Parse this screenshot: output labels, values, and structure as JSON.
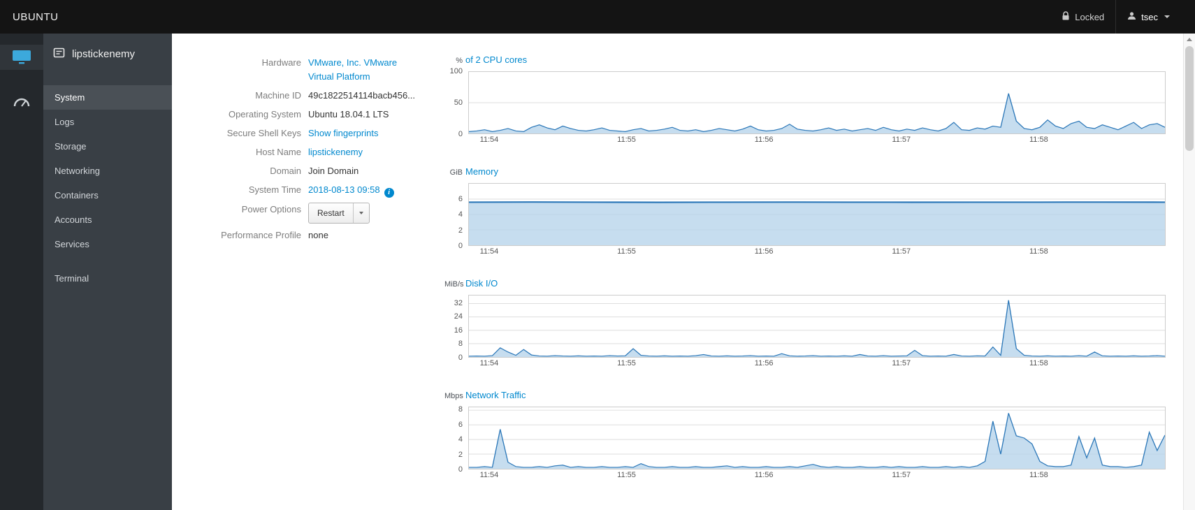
{
  "topbar": {
    "brand": "UBUNTU",
    "locked": "Locked",
    "user": "tsec"
  },
  "sidebar": {
    "host": "lipstickenemy",
    "items": [
      {
        "label": "System",
        "active": true
      },
      {
        "label": "Logs"
      },
      {
        "label": "Storage"
      },
      {
        "label": "Networking"
      },
      {
        "label": "Containers"
      },
      {
        "label": "Accounts"
      },
      {
        "label": "Services"
      },
      {
        "label": "Terminal"
      }
    ]
  },
  "details": {
    "hardware": {
      "label": "Hardware",
      "value": "VMware, Inc. VMware Virtual Platform"
    },
    "machine_id": {
      "label": "Machine ID",
      "value": "49c1822514114bacb456..."
    },
    "os": {
      "label": "Operating System",
      "value": "Ubuntu 18.04.1 LTS"
    },
    "ssh": {
      "label": "Secure Shell Keys",
      "value": "Show fingerprints"
    },
    "hostname": {
      "label": "Host Name",
      "value": "lipstickenemy"
    },
    "domain": {
      "label": "Domain",
      "value": "Join Domain"
    },
    "time": {
      "label": "System Time",
      "value": "2018-08-13 09:58",
      "info_icon": "i"
    },
    "power": {
      "label": "Power Options",
      "value": "Restart"
    },
    "profile": {
      "label": "Performance Profile",
      "value": "none"
    }
  },
  "colors": {
    "accent": "#0088ce",
    "chart_line": "#2b77b8",
    "chart_fill": "#b3d1ea",
    "grid": "#dedede",
    "topbar_bg": "#141414",
    "sidebar_bg": "#393f45",
    "sidebar_active_bg": "#4a5056"
  },
  "chart_data": [
    {
      "type": "area",
      "unit": "%",
      "title": "of 2 CPU cores",
      "ylim": [
        0,
        100
      ],
      "yticks": [
        0,
        50,
        100
      ],
      "x_labels": [
        "11:54",
        "11:55",
        "11:56",
        "11:57",
        "11:58"
      ],
      "x_fractions": [
        0.03,
        0.227,
        0.424,
        0.621,
        0.818
      ],
      "line_width": 1.2,
      "values": [
        3,
        4,
        6,
        3,
        5,
        8,
        4,
        3,
        10,
        14,
        9,
        6,
        12,
        8,
        5,
        4,
        6,
        9,
        5,
        4,
        3,
        6,
        8,
        4,
        5,
        7,
        10,
        5,
        4,
        6,
        3,
        5,
        8,
        6,
        4,
        7,
        12,
        6,
        4,
        5,
        8,
        15,
        7,
        5,
        4,
        6,
        9,
        5,
        7,
        4,
        6,
        8,
        5,
        10,
        6,
        4,
        7,
        5,
        9,
        6,
        4,
        8,
        18,
        6,
        5,
        9,
        7,
        12,
        10,
        65,
        20,
        8,
        6,
        10,
        22,
        12,
        8,
        16,
        20,
        10,
        8,
        14,
        10,
        6,
        12,
        18,
        8,
        14,
        16,
        10
      ]
    },
    {
      "type": "area",
      "unit": "GiB",
      "title": "Memory",
      "ylim": [
        0,
        8
      ],
      "yticks": [
        0,
        2,
        4,
        6
      ],
      "x_labels": [
        "11:54",
        "11:55",
        "11:56",
        "11:57",
        "11:58"
      ],
      "x_fractions": [
        0.03,
        0.227,
        0.424,
        0.621,
        0.818
      ],
      "line_width": 2.2,
      "values": [
        5.6,
        5.62,
        5.6,
        5.58,
        5.6,
        5.61,
        5.6,
        5.59,
        5.6,
        5.6,
        5.61,
        5.6
      ]
    },
    {
      "type": "area",
      "unit": "MiB/s",
      "title": "Disk I/O",
      "ylim": [
        0,
        36.8
      ],
      "yticks": [
        0,
        8,
        16,
        24,
        32
      ],
      "x_labels": [
        "11:54",
        "11:55",
        "11:56",
        "11:57",
        "11:58"
      ],
      "x_fractions": [
        0.03,
        0.227,
        0.424,
        0.621,
        0.818
      ],
      "line_width": 1.2,
      "values": [
        0.5,
        0.6,
        0.5,
        0.8,
        5.5,
        3.0,
        1.0,
        4.5,
        1.2,
        0.6,
        0.5,
        0.8,
        0.6,
        0.5,
        0.7,
        0.5,
        0.6,
        0.5,
        0.8,
        0.6,
        0.7,
        5.0,
        1.0,
        0.6,
        0.5,
        0.7,
        0.5,
        0.6,
        0.5,
        0.8,
        1.5,
        0.6,
        0.5,
        0.7,
        0.5,
        0.6,
        0.8,
        0.5,
        0.6,
        0.5,
        2.0,
        0.7,
        0.5,
        0.6,
        0.8,
        0.5,
        0.6,
        0.5,
        0.7,
        0.5,
        1.5,
        0.6,
        0.5,
        0.8,
        0.5,
        0.6,
        0.7,
        4.0,
        0.8,
        0.5,
        0.6,
        0.5,
        1.5,
        0.6,
        0.5,
        0.7,
        0.6,
        6.0,
        1.0,
        34,
        5.0,
        1.0,
        0.6,
        0.5,
        0.7,
        0.5,
        0.6,
        0.5,
        0.8,
        0.5,
        3.0,
        0.7,
        0.5,
        0.6,
        0.5,
        0.7,
        0.5,
        0.6,
        0.8,
        0.5
      ]
    },
    {
      "type": "area",
      "unit": "Mbps",
      "title": "Network Traffic",
      "ylim": [
        0,
        8.4
      ],
      "yticks": [
        0,
        2,
        4,
        6,
        8
      ],
      "x_labels": [
        "11:54",
        "11:55",
        "11:56",
        "11:57",
        "11:58"
      ],
      "x_fractions": [
        0.03,
        0.227,
        0.424,
        0.621,
        0.818
      ],
      "line_width": 1.2,
      "values": [
        0.2,
        0.2,
        0.3,
        0.2,
        5.4,
        0.9,
        0.3,
        0.2,
        0.2,
        0.3,
        0.2,
        0.4,
        0.5,
        0.2,
        0.3,
        0.2,
        0.2,
        0.3,
        0.2,
        0.2,
        0.3,
        0.2,
        0.7,
        0.3,
        0.2,
        0.2,
        0.3,
        0.2,
        0.2,
        0.3,
        0.2,
        0.2,
        0.3,
        0.4,
        0.2,
        0.3,
        0.2,
        0.2,
        0.3,
        0.2,
        0.2,
        0.3,
        0.2,
        0.4,
        0.6,
        0.3,
        0.2,
        0.3,
        0.2,
        0.2,
        0.3,
        0.2,
        0.2,
        0.3,
        0.2,
        0.3,
        0.2,
        0.2,
        0.3,
        0.2,
        0.2,
        0.3,
        0.2,
        0.3,
        0.2,
        0.4,
        1.0,
        6.5,
        2.0,
        7.6,
        4.5,
        4.2,
        3.4,
        1.0,
        0.4,
        0.3,
        0.3,
        0.5,
        4.4,
        1.5,
        4.2,
        0.5,
        0.3,
        0.3,
        0.2,
        0.3,
        0.5,
        5.0,
        2.5,
        4.6
      ]
    }
  ]
}
